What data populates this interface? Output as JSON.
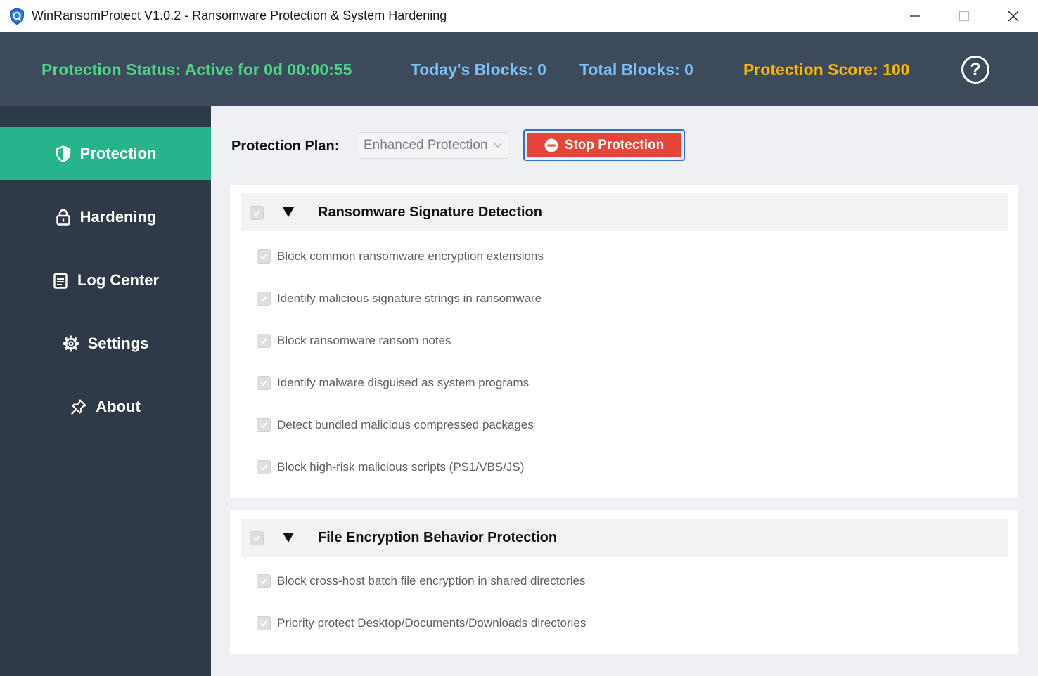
{
  "window": {
    "title": "WinRansomProtect V1.0.2 - Ransomware Protection & System Hardening",
    "icon": "shield-app-icon"
  },
  "status": {
    "protection_status": "Protection Status: Active for 0d 00:00:55",
    "todays_blocks": "Today's Blocks: 0",
    "total_blocks": "Total Blocks: 0",
    "protection_score": "Protection Score: 100",
    "help_label": "?",
    "colors": {
      "status": "#4cd68a",
      "blocks": "#7fc1f3",
      "score": "#f5b800"
    }
  },
  "sidebar": {
    "items": [
      {
        "label": "Protection",
        "icon": "shield-icon",
        "active": true
      },
      {
        "label": "Hardening",
        "icon": "lock-icon",
        "active": false
      },
      {
        "label": "Log Center",
        "icon": "clipboard-icon",
        "active": false
      },
      {
        "label": "Settings",
        "icon": "gear-icon",
        "active": false
      },
      {
        "label": "About",
        "icon": "pin-icon",
        "active": false
      }
    ],
    "active_color": "#27b48d"
  },
  "main": {
    "plan_label": "Protection Plan:",
    "plan_value": "Enhanced Protection",
    "stop_button": "Stop Protection",
    "sections": [
      {
        "title": "Ransomware Signature Detection",
        "checked": true,
        "expanded": true,
        "options": [
          {
            "label": "Block common ransomware encryption extensions",
            "checked": true
          },
          {
            "label": "Identify malicious signature strings in ransomware",
            "checked": true
          },
          {
            "label": "Block ransomware ransom notes",
            "checked": true
          },
          {
            "label": "Identify malware disguised as system programs",
            "checked": true
          },
          {
            "label": "Detect bundled malicious compressed packages",
            "checked": true
          },
          {
            "label": "Block high-risk malicious scripts (PS1/VBS/JS)",
            "checked": true
          }
        ]
      },
      {
        "title": "File Encryption Behavior Protection",
        "checked": true,
        "expanded": true,
        "options": [
          {
            "label": "Block cross-host batch file encryption in shared directories",
            "checked": true
          },
          {
            "label": "Priority protect Desktop/Documents/Downloads directories",
            "checked": true
          }
        ]
      }
    ]
  }
}
